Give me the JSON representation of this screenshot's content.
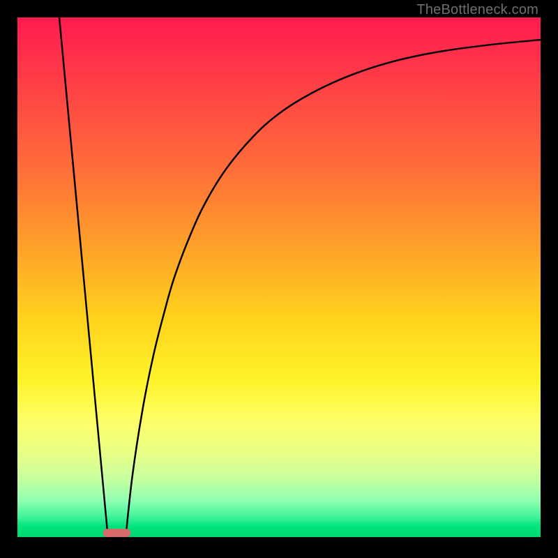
{
  "watermark": {
    "text": "TheBottleneck.com"
  },
  "chart_data": {
    "type": "line",
    "title": "",
    "xlabel": "",
    "ylabel": "",
    "xlim": [
      0,
      100
    ],
    "ylim": [
      0,
      100
    ],
    "series": [
      {
        "name": "left-line",
        "x": [
          8.0,
          17.3
        ],
        "values": [
          100,
          0
        ]
      },
      {
        "name": "right-curve",
        "x": [
          20.7,
          22,
          24,
          26,
          28,
          30,
          33,
          36,
          40,
          45,
          50,
          56,
          63,
          71,
          80,
          90,
          100
        ],
        "values": [
          0,
          12,
          25,
          35,
          43,
          50,
          58,
          64.5,
          71,
          77,
          81.5,
          85.3,
          88.6,
          91.3,
          93.3,
          94.7,
          95.7
        ]
      }
    ],
    "marker": {
      "x_center": 19.0,
      "y": 0,
      "width": 5.3,
      "height": 1.6,
      "color": "#d86a6a"
    },
    "background_gradient": {
      "top": "#ff1a4f",
      "mid_top": "#ff9a2c",
      "mid": "#fff42a",
      "mid_bottom": "#c4ffa0",
      "bottom": "#00d86f"
    }
  }
}
